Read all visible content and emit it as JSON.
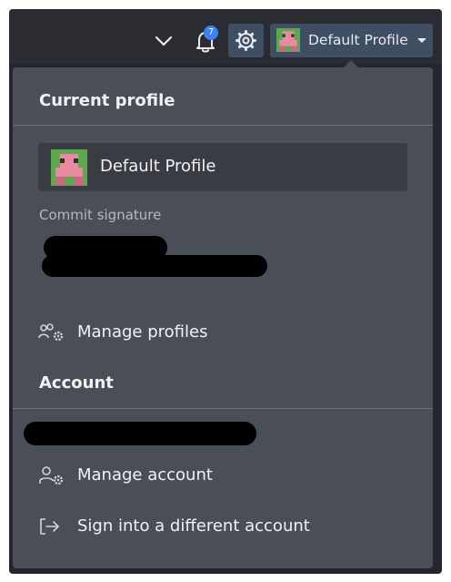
{
  "topbar": {
    "notifications_count": "7",
    "profile_button_label": "Default Profile"
  },
  "panel": {
    "current_profile_heading": "Current profile",
    "profile_name": "Default Profile",
    "commit_signature_label": "Commit signature",
    "manage_profiles_label": "Manage profiles",
    "account_heading": "Account",
    "manage_account_label": "Manage account",
    "sign_in_different_label": "Sign into a different account"
  },
  "colors": {
    "accent": "#3f4f63",
    "panel_background": "#4a4e57",
    "badge": "#3b82f6",
    "avatar_green": "#5ba84e",
    "avatar_pink": "#e88aa0"
  },
  "icons": {
    "chevron": "chevron-down-icon",
    "bell": "bell-icon",
    "settings": "gear-icon",
    "manage_profiles": "users-gear-icon",
    "manage_account": "user-gear-icon",
    "sign_in": "sign-in-arrow-icon"
  }
}
